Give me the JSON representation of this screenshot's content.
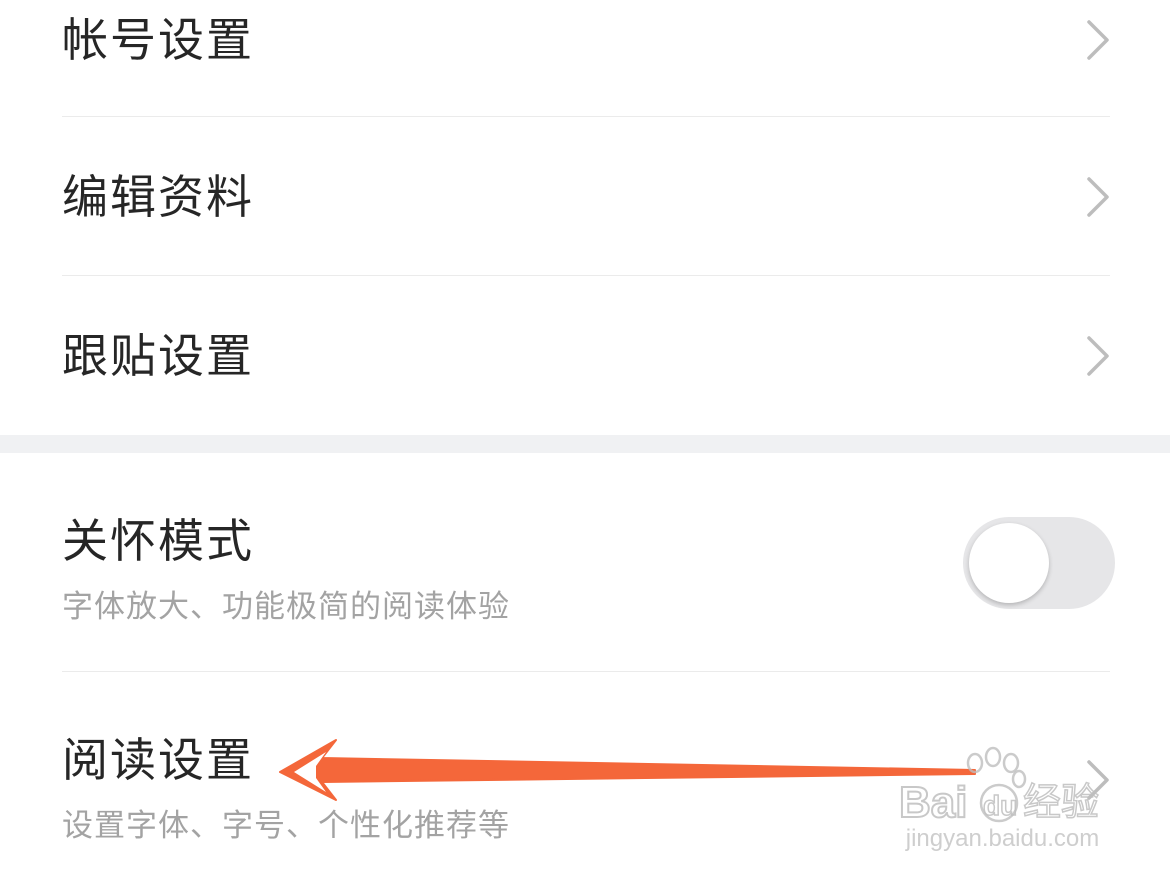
{
  "settings": {
    "items": [
      {
        "label": "帐号设置"
      },
      {
        "label": "编辑资料"
      },
      {
        "label": "跟贴设置"
      }
    ],
    "care_mode": {
      "label": "关怀模式",
      "description": "字体放大、功能极简的阅读体验",
      "enabled": false
    },
    "reading": {
      "label": "阅读设置",
      "description": "设置字体、字号、个性化推荐等"
    }
  },
  "colors": {
    "annotation_arrow": "#f4673a",
    "toggle_off_track": "#e6e6e8",
    "section_gap": "#f0f1f3"
  },
  "watermark": {
    "brand": "Baidu经验",
    "url": "jingyan.baidu.com"
  }
}
